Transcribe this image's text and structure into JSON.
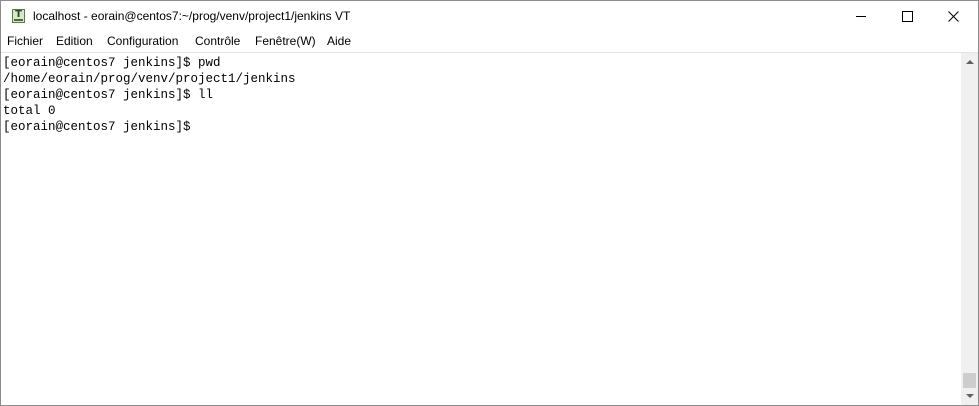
{
  "window": {
    "title": "localhost - eorain@centos7:~/prog/venv/project1/jenkins VT",
    "icon": "terminal-app-icon",
    "icon_letter": "T"
  },
  "menu": {
    "items": [
      {
        "label": "Fichier"
      },
      {
        "label": "Edition"
      },
      {
        "label": "Configuration"
      },
      {
        "label": "Contrôle"
      },
      {
        "label": "Fenêtre(W)"
      },
      {
        "label": "Aide"
      }
    ]
  },
  "terminal": {
    "lines": [
      "[eorain@centos7 jenkins]$ pwd",
      "/home/eorain/prog/venv/project1/jenkins",
      "[eorain@centos7 jenkins]$ ll",
      "total 0",
      "[eorain@centos7 jenkins]$"
    ],
    "scroll_position": 1.0
  },
  "colors": {
    "background": "#ffffff",
    "text": "#000000",
    "scrollbar_track": "#f0f0f0",
    "scrollbar_thumb": "#cdcdcd"
  }
}
